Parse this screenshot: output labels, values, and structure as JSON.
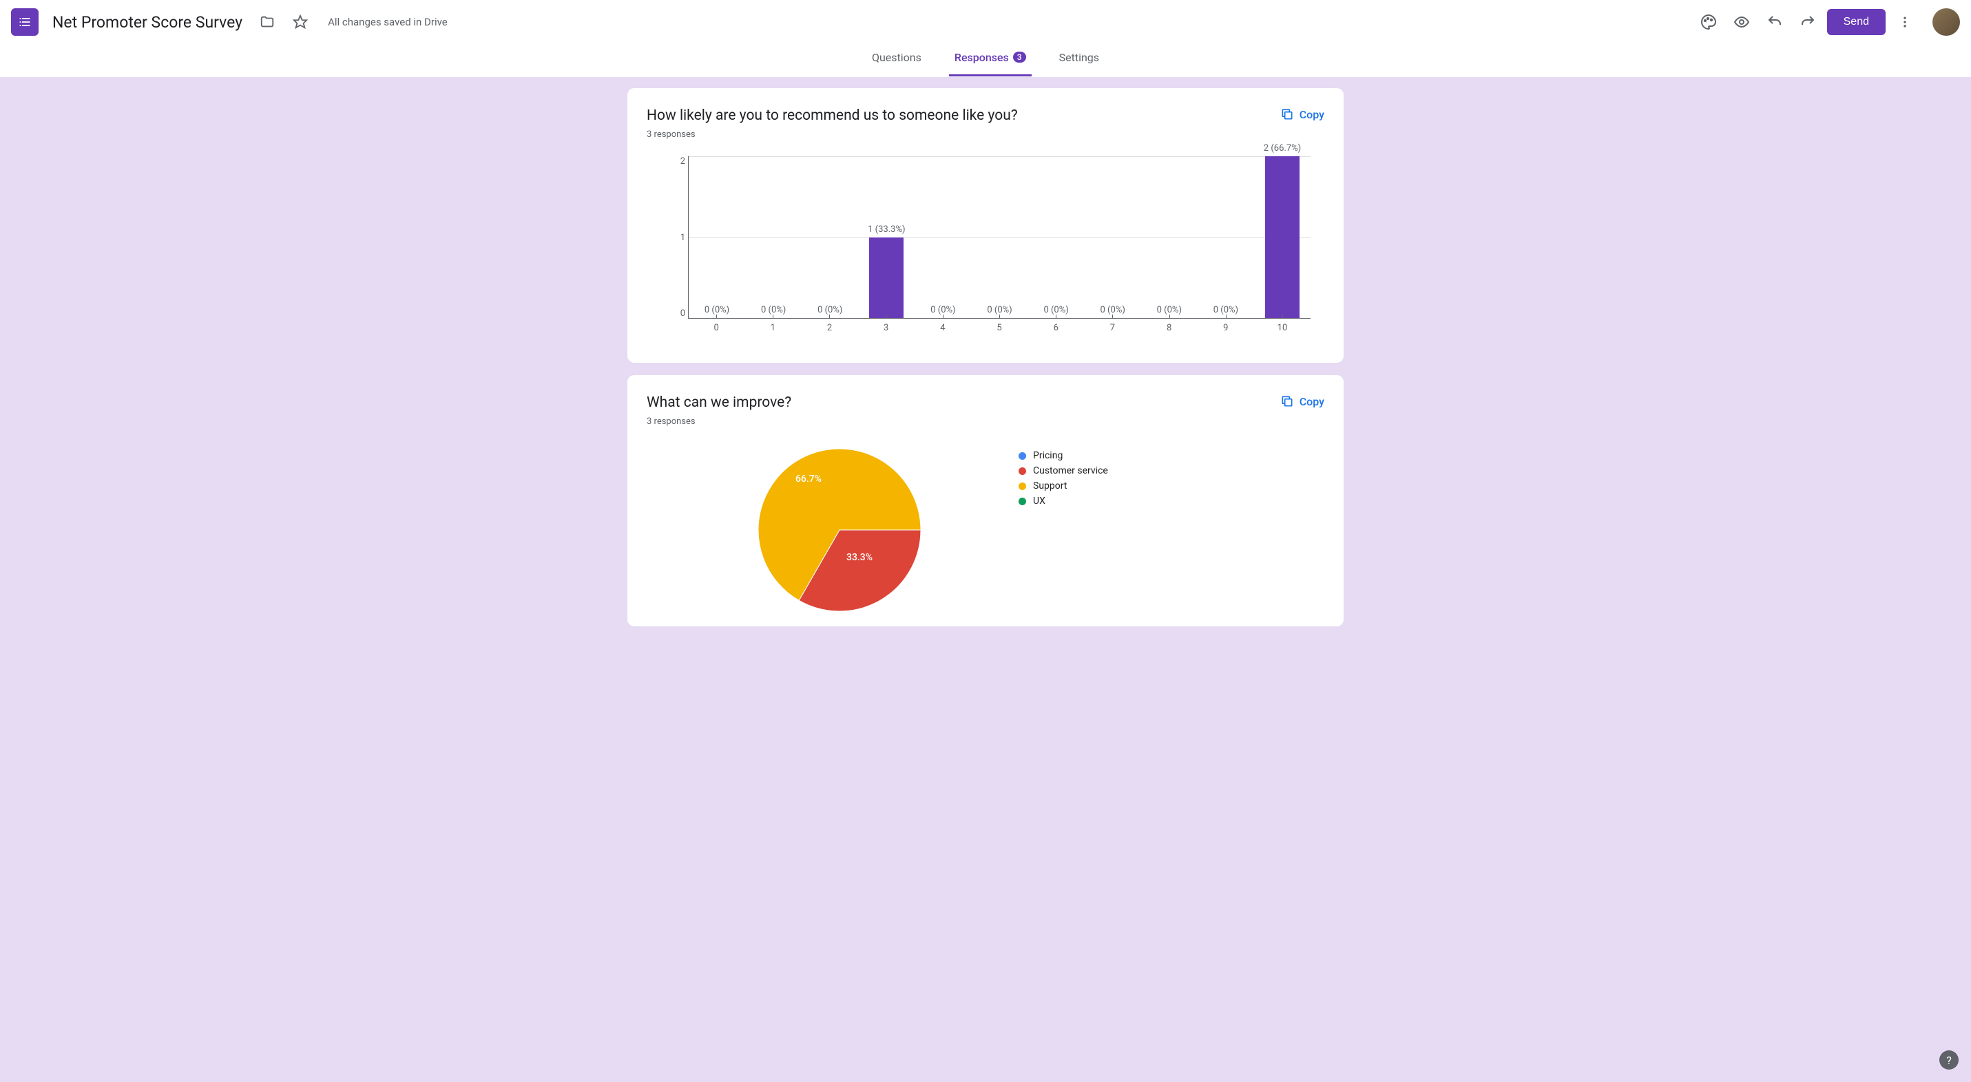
{
  "doc_title": "Net Promoter Score Survey",
  "save_status": "All changes saved in Drive",
  "send_button": "Send",
  "tabs": {
    "questions": "Questions",
    "responses": "Responses",
    "responses_count": "3",
    "settings": "Settings"
  },
  "card1": {
    "title": "How likely are you to recommend us to someone like you?",
    "responses": "3 responses",
    "copy": "Copy"
  },
  "card2": {
    "title": "What can we improve?",
    "responses": "3 responses",
    "copy": "Copy"
  },
  "chart_data": [
    {
      "type": "bar",
      "categories": [
        "0",
        "1",
        "2",
        "3",
        "4",
        "5",
        "6",
        "7",
        "8",
        "9",
        "10"
      ],
      "values": [
        0,
        0,
        0,
        1,
        0,
        0,
        0,
        0,
        0,
        0,
        2
      ],
      "labels": [
        "0 (0%)",
        "0 (0%)",
        "0 (0%)",
        "1 (33.3%)",
        "0 (0%)",
        "0 (0%)",
        "0 (0%)",
        "0 (0%)",
        "0 (0%)",
        "0 (0%)",
        "2 (66.7%)"
      ],
      "ylim": [
        0,
        2
      ],
      "yticks": [
        "0",
        "1",
        "2"
      ],
      "bar_color": "#673ab7"
    },
    {
      "type": "pie",
      "series": [
        {
          "name": "Pricing",
          "value": 0,
          "color": "#4285f4"
        },
        {
          "name": "Customer service",
          "value": 33.3,
          "color": "#db4437"
        },
        {
          "name": "Support",
          "value": 66.7,
          "color": "#f4b400"
        },
        {
          "name": "UX",
          "value": 0,
          "color": "#0f9d58"
        }
      ],
      "slice_labels": {
        "support": "66.7%",
        "customer_service": "33.3%"
      }
    }
  ],
  "legend": {
    "pricing": "Pricing",
    "customer_service": "Customer service",
    "support": "Support",
    "ux": "UX"
  },
  "help": "?"
}
